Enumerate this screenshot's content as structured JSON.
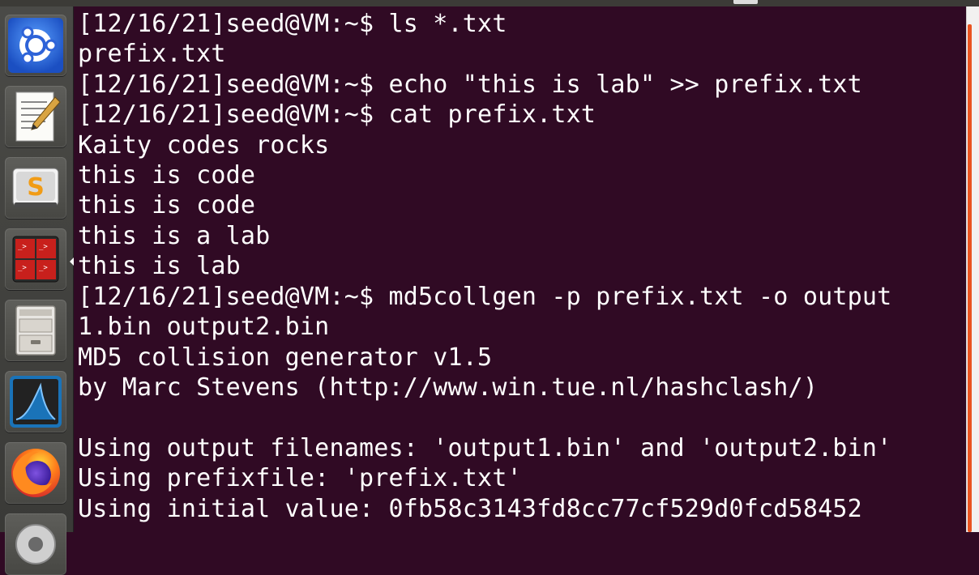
{
  "launcher": {
    "items": [
      {
        "name": "ubuntu-dash",
        "icon": "ubuntu-logo-icon"
      },
      {
        "name": "text-editor",
        "icon": "text-editor-icon"
      },
      {
        "name": "sublime-text",
        "icon": "sublime-text-icon",
        "glyph": "S"
      },
      {
        "name": "terminator",
        "icon": "terminator-icon"
      },
      {
        "name": "file-manager",
        "icon": "file-cabinet-icon"
      },
      {
        "name": "wireshark",
        "icon": "wireshark-fin-icon"
      },
      {
        "name": "firefox",
        "icon": "firefox-icon"
      },
      {
        "name": "system-settings",
        "icon": "gear-icon"
      }
    ]
  },
  "terminal": {
    "background": "#300a24",
    "foreground": "#ffffff",
    "lines": [
      "[12/16/21]seed@VM:~$ ls *.txt",
      "prefix.txt",
      "[12/16/21]seed@VM:~$ echo \"this is lab\" >> prefix.txt",
      "[12/16/21]seed@VM:~$ cat prefix.txt",
      "Kaity codes rocks",
      "this is code",
      "this is code",
      "this is a lab",
      "this is lab",
      "[12/16/21]seed@VM:~$ md5collgen -p prefix.txt -o output",
      "1.bin output2.bin",
      "MD5 collision generator v1.5",
      "by Marc Stevens (http://www.win.tue.nl/hashclash/)",
      "",
      "Using output filenames: 'output1.bin' and 'output2.bin'",
      "Using prefixfile: 'prefix.txt'",
      "Using initial value: 0fb58c3143fd8cc77cf529d0fcd58452"
    ]
  },
  "colors": {
    "accent": "#e95420",
    "launcher": "#4a4a47"
  }
}
